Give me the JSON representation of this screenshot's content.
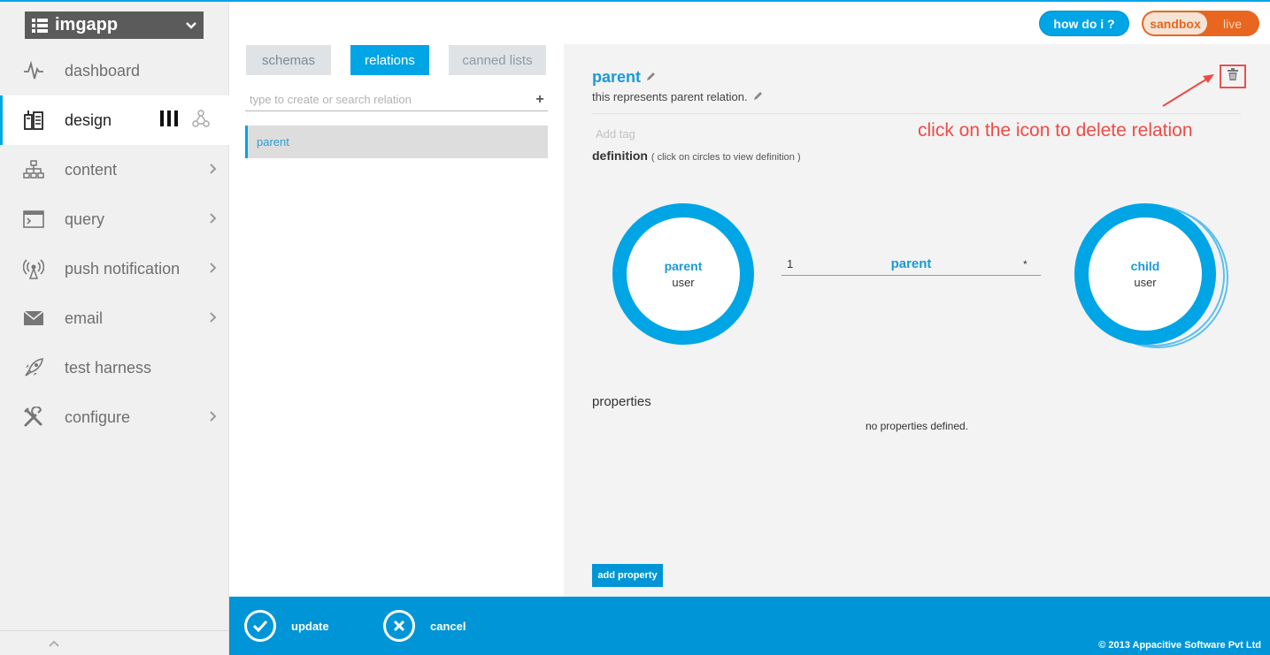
{
  "app": {
    "name": "imgapp"
  },
  "sidebar": {
    "items": [
      {
        "label": "dashboard",
        "icon": "pulse-icon",
        "has_arrow": false
      },
      {
        "label": "design",
        "icon": "design-icon",
        "active": true
      },
      {
        "label": "content",
        "icon": "sitemap-icon",
        "has_arrow": true
      },
      {
        "label": "query",
        "icon": "terminal-icon",
        "has_arrow": true
      },
      {
        "label": "push notification",
        "icon": "broadcast-icon",
        "has_arrow": true
      },
      {
        "label": "email",
        "icon": "envelope-icon",
        "has_arrow": true
      },
      {
        "label": "test harness",
        "icon": "rocket-icon",
        "has_arrow": false
      },
      {
        "label": "configure",
        "icon": "wrench-icon",
        "has_arrow": true
      }
    ]
  },
  "header": {
    "howdoi_label": "how do i ?",
    "env_active": "sandbox",
    "env_inactive": "live"
  },
  "tabs": {
    "schemas": "schemas",
    "relations": "relations",
    "canned": "canned lists"
  },
  "search": {
    "placeholder": "type to create or search relation"
  },
  "relation_list": {
    "items": [
      "parent"
    ]
  },
  "detail": {
    "title": "parent",
    "description": "this represents parent relation.",
    "add_tag_placeholder": "Add tag",
    "definition_label": "definition",
    "definition_hint": "( click on circles to view definition )",
    "left_end": {
      "label": "parent",
      "type": "user"
    },
    "right_end": {
      "label": "child",
      "type": "user"
    },
    "connector": {
      "left_multiplicity": "1",
      "name": "parent",
      "right_multiplicity": "*"
    },
    "properties_label": "properties",
    "no_properties_text": "no properties defined.",
    "add_property_label": "add property"
  },
  "annotation": {
    "text": "click on the icon to delete relation",
    "color": "#ee4b47"
  },
  "footer": {
    "update_label": "update",
    "cancel_label": "cancel",
    "copyright": "© 2013 Appacitive Software Pvt Ltd"
  },
  "colors": {
    "accent": "#00a5e6",
    "footer": "#0095d6",
    "env": "#e8661f"
  }
}
